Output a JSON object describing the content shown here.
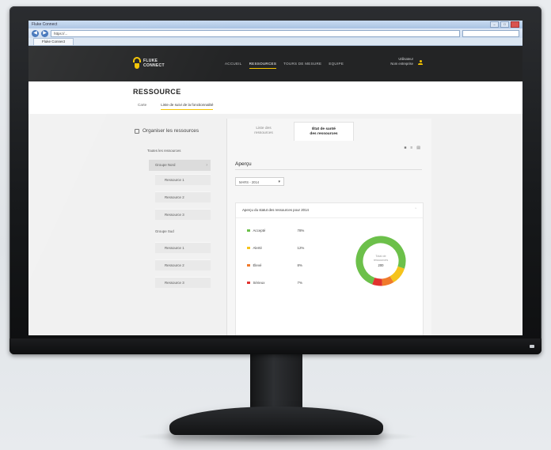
{
  "browser": {
    "window_title": "Fluke Connect",
    "address": "https://...",
    "tab_label": "Fluke Connect",
    "nav_back": "◀",
    "nav_forward": "▶"
  },
  "header": {
    "logo_line1": "FLUKE",
    "logo_line2": "CONNECT",
    "nav": [
      "ACCUEIL",
      "RESSOURCES",
      "TOURS DE MESURE",
      "EQUIPE"
    ],
    "active_nav_index": 1,
    "user_name": "Utilisateur",
    "user_company": "Nom entreprise"
  },
  "page": {
    "title": "RESSOURCE",
    "subtabs": [
      "Carte",
      "Liste de suivi de la fonctionnalité"
    ],
    "active_subtab_index": 1
  },
  "sidebar": {
    "organize_label": "Organiser les ressources",
    "items": [
      {
        "label": "Toutes les ressources",
        "level": 0
      },
      {
        "label": "Groupe Nord",
        "level": 1,
        "selected": true
      },
      {
        "label": "Ressource 1",
        "level": 2
      },
      {
        "label": "Ressource 2",
        "level": 2
      },
      {
        "label": "Ressource 3",
        "level": 2
      },
      {
        "label": "Groupe Sud",
        "level": 1
      },
      {
        "label": "Ressource 1",
        "level": 2
      },
      {
        "label": "Ressource 2",
        "level": 2
      },
      {
        "label": "Ressource 3",
        "level": 2
      }
    ]
  },
  "main": {
    "tabs": [
      {
        "line1": "Liste des",
        "line2": "ressources"
      },
      {
        "line1": "État de santé",
        "line2": "des ressources"
      }
    ],
    "active_tab_index": 1,
    "view_icons": [
      "grid-icon",
      "list-icon",
      "chart-icon"
    ],
    "apercu_title": "Aperçu",
    "period_select": "MARS - 2014",
    "card_title": "Aperçu du statut des ressources pour 2014",
    "status": [
      {
        "label": "Accepté",
        "value": "78%",
        "color": "#6cc04a"
      },
      {
        "label": "Alerté",
        "value": "12%",
        "color": "#f5c31c"
      },
      {
        "label": "Élevé",
        "value": "8%",
        "color": "#f07a2b"
      },
      {
        "label": "Sérieux",
        "value": "7%",
        "color": "#e1322f"
      }
    ],
    "donut_center_label": "Total de ressources",
    "donut_center_value": "200"
  },
  "chart_data": {
    "type": "pie",
    "categories": [
      "Accepté",
      "Alerté",
      "Élevé",
      "Sérieux"
    ],
    "values": [
      78,
      12,
      8,
      7
    ],
    "colors": [
      "#6cc04a",
      "#f5c31c",
      "#f07a2b",
      "#e1322f"
    ],
    "title": "Aperçu du statut des ressources pour 2014"
  }
}
